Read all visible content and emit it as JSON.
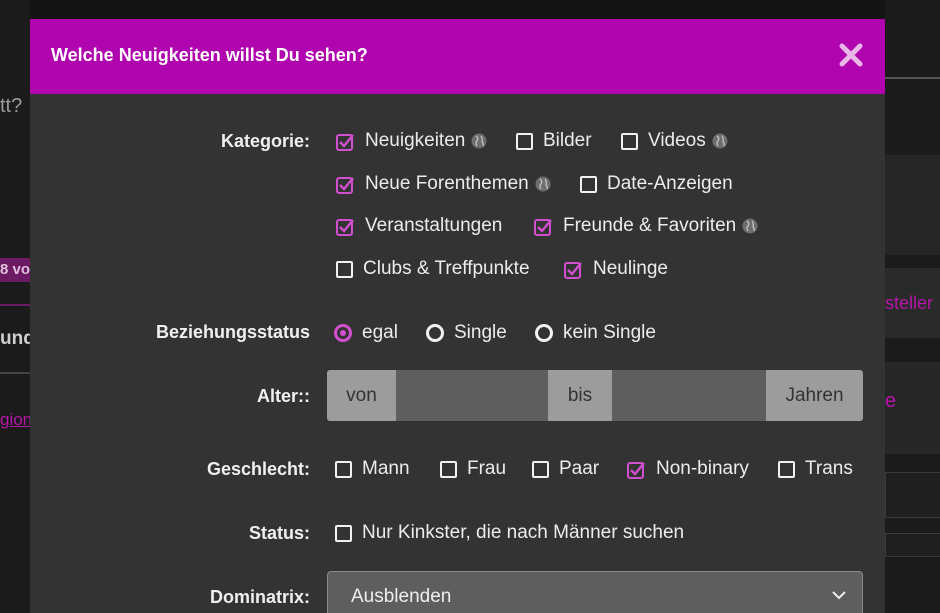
{
  "background": {
    "left_fragments": {
      "question": "tt?",
      "badge": "8 vo",
      "und": "und",
      "gion": "gion"
    },
    "right_fragments": {
      "stellen": "steller",
      "e": "e"
    }
  },
  "modal": {
    "title": "Welche Neuigkeiten willst Du sehen?",
    "close_icon": "close-icon",
    "accent_color": "#b005ae",
    "kategorie": {
      "label": "Kategorie:",
      "options": [
        {
          "label": "Neuigkeiten",
          "checked": true,
          "globe": true
        },
        {
          "label": "Bilder",
          "checked": false,
          "globe": false
        },
        {
          "label": "Videos",
          "checked": false,
          "globe": true
        },
        {
          "label": "Neue Forenthemen",
          "checked": true,
          "globe": true
        },
        {
          "label": "Date-Anzeigen",
          "checked": false,
          "globe": false
        },
        {
          "label": "Veranstaltungen",
          "checked": true,
          "globe": false
        },
        {
          "label": "Freunde & Favoriten",
          "checked": true,
          "globe": true
        },
        {
          "label": "Clubs & Treffpunkte",
          "checked": false,
          "globe": false
        },
        {
          "label": "Neulinge",
          "checked": true,
          "globe": false
        }
      ]
    },
    "beziehungsstatus": {
      "label": "Beziehungsstatus",
      "options": [
        {
          "label": "egal",
          "selected": true
        },
        {
          "label": "Single",
          "selected": false
        },
        {
          "label": "kein Single",
          "selected": false
        }
      ]
    },
    "alter": {
      "label": "Alter::",
      "from_label": "von",
      "to_label": "bis",
      "unit_label": "Jahren",
      "from_value": "",
      "to_value": ""
    },
    "geschlecht": {
      "label": "Geschlecht:",
      "options": [
        {
          "label": "Mann",
          "checked": false
        },
        {
          "label": "Frau",
          "checked": false
        },
        {
          "label": "Paar",
          "checked": false
        },
        {
          "label": "Non-binary",
          "checked": true
        },
        {
          "label": "Trans",
          "checked": false
        }
      ]
    },
    "status": {
      "label": "Status:",
      "option": {
        "label": "Nur Kinkster, die nach Männer suchen",
        "checked": false
      }
    },
    "dominatrix": {
      "label": "Dominatrix:",
      "selected": "Ausblenden"
    }
  }
}
